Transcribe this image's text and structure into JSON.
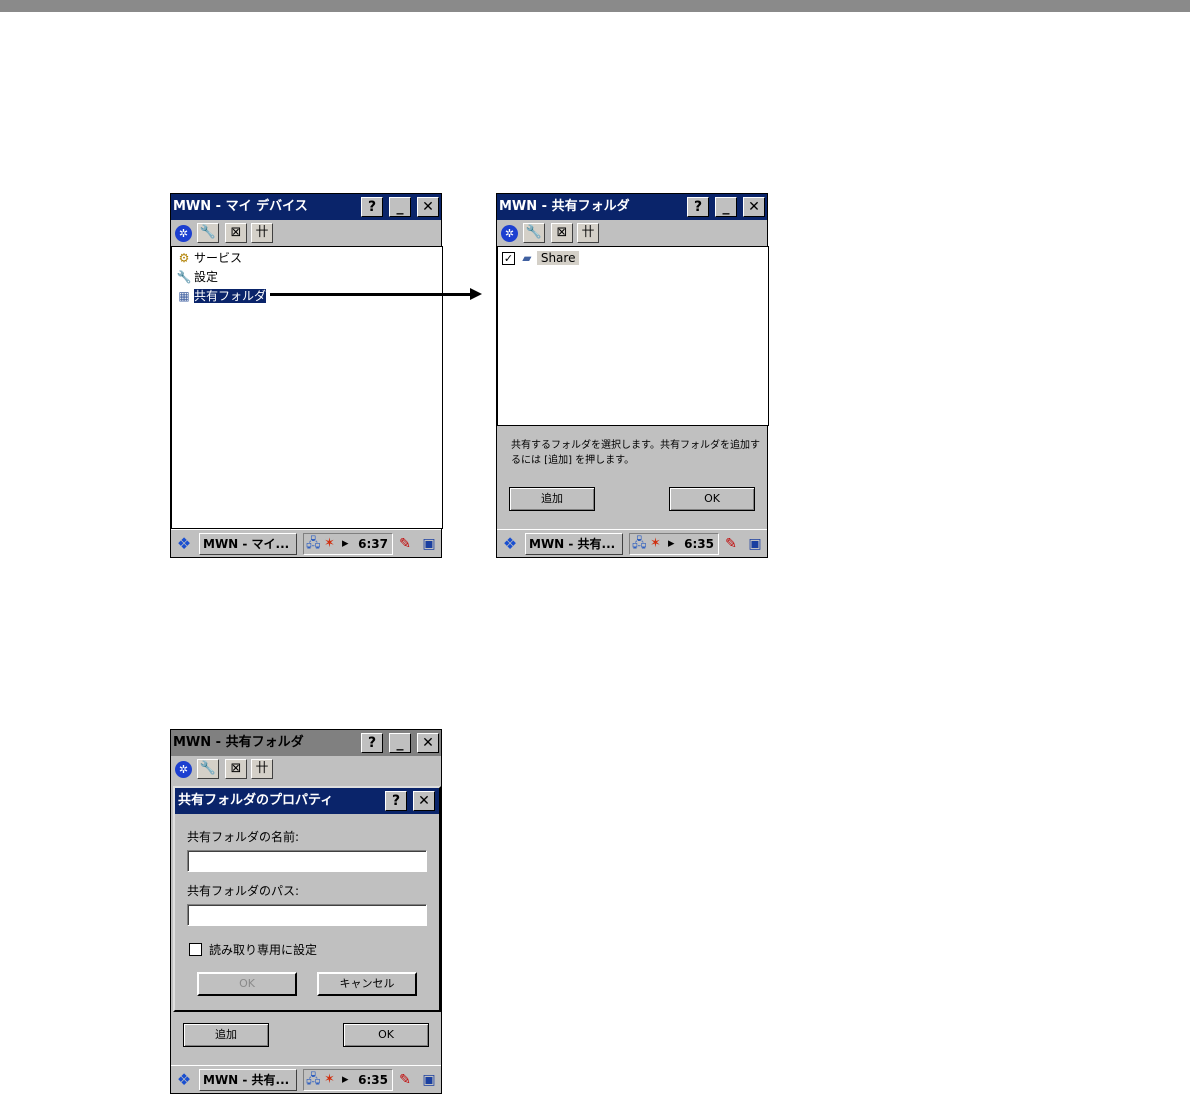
{
  "screen1": {
    "title": "MWN - マイ デバイス",
    "items": [
      {
        "icon": "services-icon",
        "glyph": "⚙",
        "label": "サービス"
      },
      {
        "icon": "wrench-icon",
        "glyph": "🔧",
        "label": "設定"
      },
      {
        "icon": "shared-folder-icon",
        "glyph": "▦",
        "label": "共有フォルダ"
      }
    ],
    "taskbar": {
      "task": "MWN - マイ...",
      "time": "6:37"
    }
  },
  "screen2": {
    "title": "MWN - 共有フォルダ",
    "items": [
      {
        "checked": true,
        "label": "Share"
      }
    ],
    "message": "共有するフォルダを選択します。共有フォルダを追加するには [追加] を押します。",
    "add_button": "追加",
    "ok_button": "OK",
    "taskbar": {
      "task": "MWN - 共有...",
      "time": "6:35"
    }
  },
  "screen3": {
    "title": "MWN - 共有フォルダ",
    "dialog": {
      "title": "共有フォルダのプロパティ",
      "name_label": "共有フォルダの名前:",
      "name_value": "",
      "path_label": "共有フォルダのパス:",
      "path_value": "",
      "readonly_label": "読み取り専用に設定",
      "readonly_checked": false,
      "ok_button": "OK",
      "cancel_button": "キャンセル"
    },
    "add_button": "追加",
    "ok_button": "OK",
    "taskbar": {
      "task": "MWN - 共有...",
      "time": "6:35"
    }
  },
  "common": {
    "help_glyph": "?",
    "minimize_glyph": "_",
    "close_glyph": "✕",
    "tool_glyphs": [
      "✲",
      "🔧",
      "⊠",
      "卄"
    ],
    "start_glyph": "❖",
    "tray_glyphs": [
      "🖧",
      "✶",
      "▸"
    ],
    "input_glyph": "✎",
    "switch_glyph": "▣"
  }
}
